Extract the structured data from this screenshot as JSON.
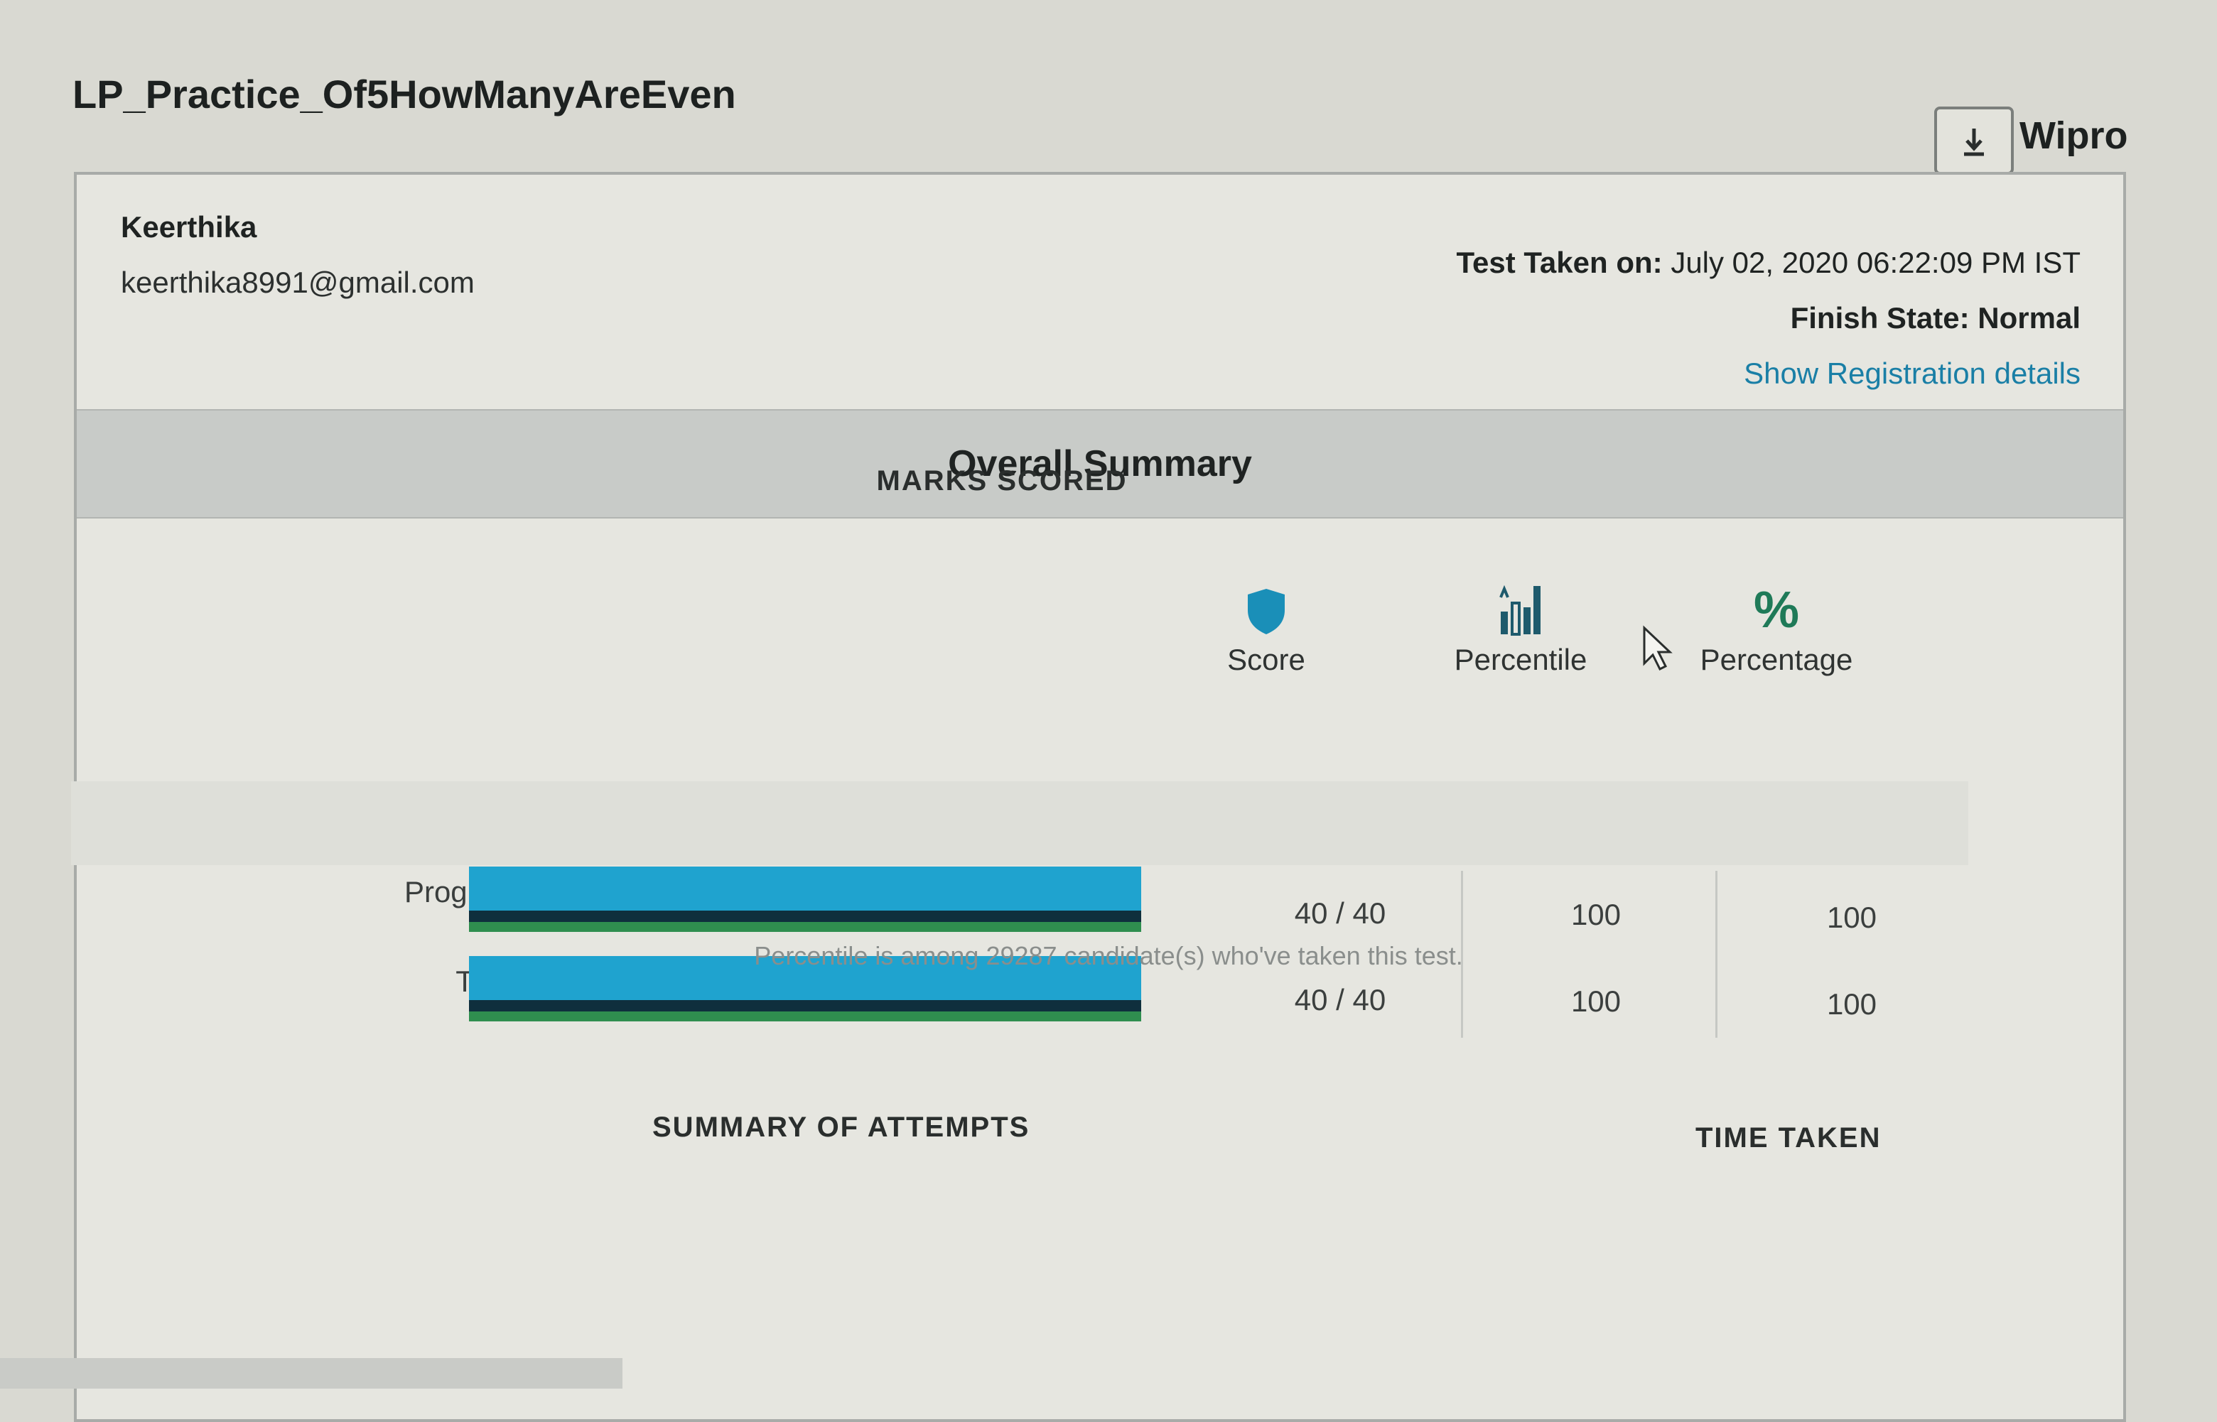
{
  "header": {
    "test_name": "LP_Practice_Of5HowManyAreEven",
    "brand": "Wipro",
    "download_icon": "download-icon"
  },
  "candidate": {
    "name": "Keerthika",
    "email": "keerthika8991@gmail.com"
  },
  "test_info": {
    "taken_on_label": "Test Taken on:",
    "taken_on_value": "July 02, 2020 06:22:09 PM IST",
    "finish_state_label": "Finish State:",
    "finish_state_value": "Normal",
    "registration_link": "Show Registration details"
  },
  "summary": {
    "title": "Overall Summary",
    "marks_heading": "MARKS SCORED",
    "columns": [
      {
        "label": "Score",
        "icon": "shield-icon"
      },
      {
        "label": "Percentile",
        "icon": "bar-chart-icon"
      },
      {
        "label": "Percentage",
        "icon": "percent-icon"
      }
    ],
    "rows": [
      {
        "label": "Program",
        "score": "40 / 40",
        "percentile": "100",
        "percentage": "100",
        "fill": 1.0
      },
      {
        "label": "Total",
        "score": "40 / 40",
        "percentile": "100",
        "percentage": "100",
        "fill": 1.0
      }
    ],
    "footnote": "Percentile is among 29287 candidate(s) who've taken this test.",
    "attempts_heading": "SUMMARY OF ATTEMPTS",
    "time_heading": "TIME TAKEN"
  },
  "colors": {
    "bar_primary": "#1fa3cf",
    "bar_dark": "#0f2f3d",
    "bar_green": "#2f8e4f",
    "icon_accent": "#1a8fb8",
    "link": "#1a7fa6"
  }
}
